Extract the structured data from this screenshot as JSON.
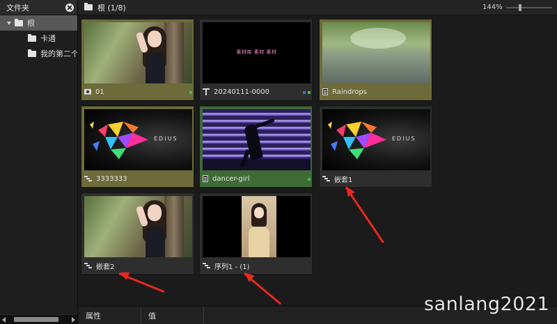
{
  "folder_panel": {
    "title": "文件夹",
    "tree": [
      {
        "label": "根",
        "selected": true
      },
      {
        "label": "卡通"
      },
      {
        "label": "我的第二个"
      }
    ]
  },
  "bin": {
    "title": "根 (1/8)",
    "zoom": "144%",
    "clips": [
      {
        "name": "01",
        "type": "still-image",
        "icon": "camera-icon",
        "color": "#6d6b39"
      },
      {
        "name": "20240111-0000",
        "type": "title",
        "icon": "title-icon",
        "color": "#2e2e2e",
        "thumb_text": "素材库 素材 素材"
      },
      {
        "name": "Raindrops",
        "type": "video",
        "icon": "clip-icon",
        "color": "#6d6b39"
      },
      {
        "name": "3333333",
        "type": "sequence",
        "icon": "sequence-icon",
        "color": "#6d6b39",
        "thumb_text": "EDIUS"
      },
      {
        "name": "dancer-girl",
        "type": "video",
        "icon": "clip-icon",
        "color": "#3f6a36"
      },
      {
        "name": "嵌套1",
        "type": "sequence",
        "icon": "sequence-icon",
        "color": "#2e2e2e",
        "thumb_text": "EDIUS"
      },
      {
        "name": "嵌套2",
        "type": "sequence",
        "icon": "sequence-icon",
        "color": "#2e2e2e"
      },
      {
        "name": "序列1 - (1)",
        "type": "sequence",
        "icon": "sequence-icon",
        "color": "#2e2e2e"
      }
    ]
  },
  "properties": {
    "col_property": "属性",
    "col_value": "值"
  },
  "watermark": "sanlang2021",
  "colors": {
    "annotation_arrow": "#e8291e",
    "selected_tree": "#585858"
  }
}
